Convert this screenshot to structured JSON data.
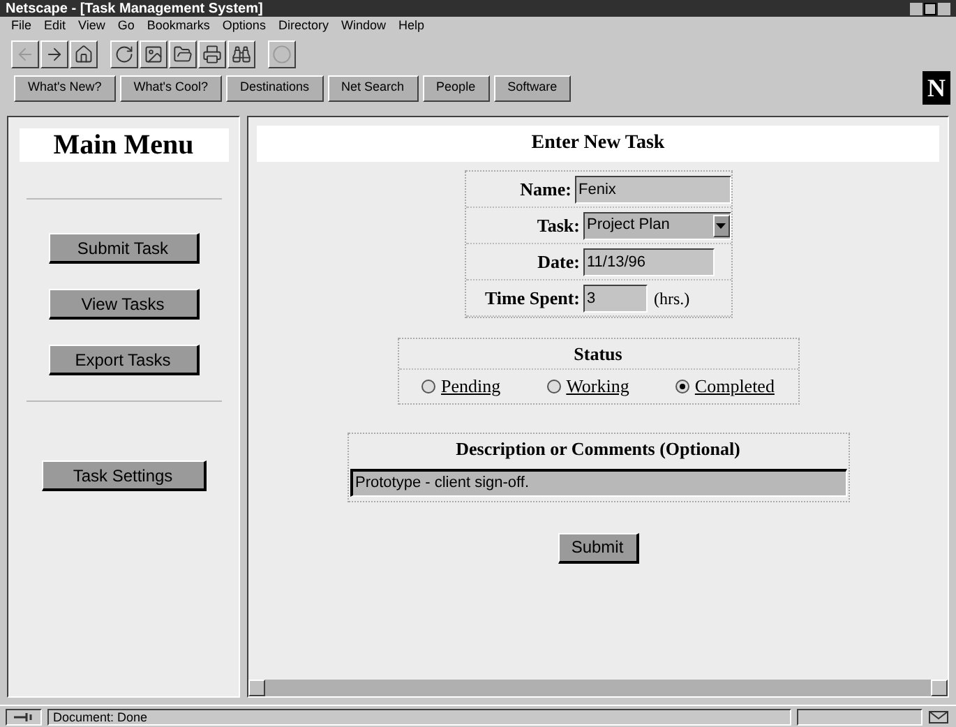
{
  "window": {
    "title": "Netscape - [Task Management System]"
  },
  "menu": [
    "File",
    "Edit",
    "View",
    "Go",
    "Bookmarks",
    "Options",
    "Directory",
    "Window",
    "Help"
  ],
  "toolbar": [
    {
      "kind": "back",
      "disabled": true
    },
    {
      "kind": "forward",
      "disabled": false
    },
    {
      "kind": "home",
      "disabled": false
    },
    {
      "kind": "reload",
      "disabled": false
    },
    {
      "kind": "images",
      "disabled": false
    },
    {
      "kind": "open",
      "disabled": false
    },
    {
      "kind": "print",
      "disabled": false
    },
    {
      "kind": "find",
      "disabled": false
    },
    {
      "kind": "stop",
      "disabled": true
    }
  ],
  "directory_buttons": [
    "What's New?",
    "What's Cool?",
    "Destinations",
    "Net Search",
    "People",
    "Software"
  ],
  "logo": "N",
  "main_menu": {
    "title": "Main Menu",
    "buttons": [
      "Submit Task",
      "View Tasks",
      "Export Tasks",
      "Task Settings"
    ]
  },
  "form": {
    "title": "Enter New Task",
    "fields": [
      {
        "kind": "text",
        "label": "Name:",
        "value": "Fenix"
      },
      {
        "kind": "select",
        "label": "Task:",
        "value": "Project Plan"
      },
      {
        "kind": "text",
        "label": "Date:",
        "value": "11/13/96"
      },
      {
        "kind": "short",
        "label": "Time Spent:",
        "value": "3",
        "unit": "(hrs.)"
      }
    ],
    "status": {
      "title": "Status",
      "options": [
        {
          "label": "Pending",
          "selected": false
        },
        {
          "label": "Working",
          "selected": false
        },
        {
          "label": "Completed",
          "selected": true
        }
      ]
    },
    "description": {
      "label": "Description or Comments (Optional)",
      "value": "Prototype - client sign-off."
    },
    "submit": "Submit"
  },
  "status_bar": {
    "text": "Document: Done"
  }
}
